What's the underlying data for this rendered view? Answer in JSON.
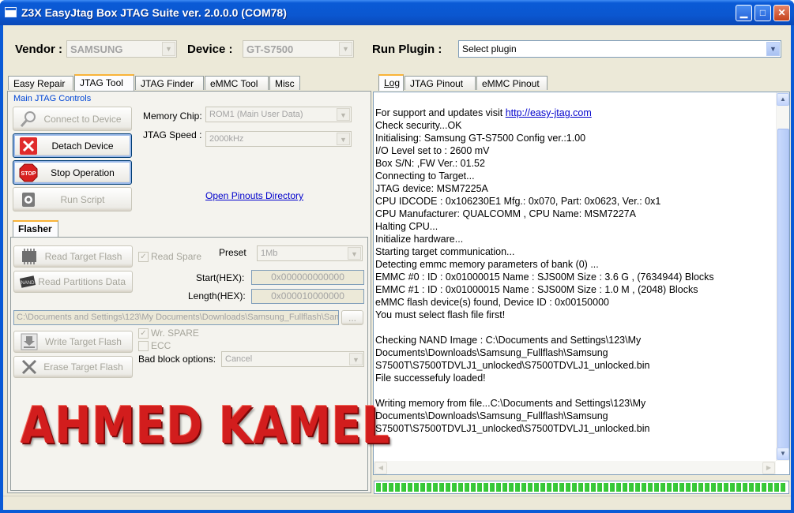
{
  "window": {
    "title": "Z3X EasyJtag Box JTAG Suite ver. 2.0.0.0 (COM78)"
  },
  "toolbar": {
    "vendor_label": "Vendor :",
    "vendor_value": "SAMSUNG",
    "device_label": "Device :",
    "device_value": "GT-S7500",
    "plugin_label": "Run Plugin :",
    "plugin_value": "Select plugin"
  },
  "left_tabs": [
    "Easy Repair",
    "JTAG Tool",
    "JTAG Finder",
    "eMMC Tool",
    "Misc"
  ],
  "left_active_tab": "JTAG Tool",
  "jtag_controls": {
    "group_title": "Main JTAG Controls",
    "connect_label": "Connect to Device",
    "detach_label": "Detach Device",
    "stop_label": "Stop Operation",
    "script_label": "Run Script",
    "memchip_label": "Memory Chip:",
    "memchip_value": "ROM1 (Main User Data)",
    "speed_label": "JTAG Speed :",
    "speed_value": "2000kHz",
    "pinouts_link": "Open Pinouts Directory"
  },
  "flasher": {
    "tab_label": "Flasher",
    "read_target_label": "Read Target Flash",
    "read_partitions_label": "Read Partitions Data",
    "read_spare_label": "Read Spare",
    "preset_label": "Preset",
    "preset_value": "1Mb",
    "start_label": "Start(HEX):",
    "start_value": "0x000000000000",
    "length_label": "Length(HEX):",
    "length_value": "0x000010000000",
    "file_path": "C:\\Documents and Settings\\123\\My Documents\\Downloads\\Samsung_Fullflash\\Sam",
    "browse_label": "...",
    "write_target_label": "Write Target Flash",
    "erase_target_label": "Erase Target Flash",
    "wr_spare_label": "Wr. SPARE",
    "ecc_label": "ECC",
    "badblock_label": "Bad block options:",
    "badblock_value": "Cancel"
  },
  "right_tabs": [
    "Log",
    "JTAG Pinout",
    "eMMC Pinout"
  ],
  "right_active_tab": "Log",
  "log": {
    "support_prefix": "For support and updates visit ",
    "support_link": "http://easy-jtag.com",
    "lines": [
      "Check security...OK",
      "Initialising: Samsung GT-S7500 Config ver.:1.00",
      "I/O Level set to : 2600 mV",
      "Box S/N:                    ,FW Ver.: 01.52",
      "Connecting to Target...",
      "JTAG device: MSM7225A",
      "CPU IDCODE : 0x106230E1 Mfg.: 0x070, Part: 0x0623, Ver.: 0x1",
      "CPU Manufacturer: QUALCOMM , CPU Name: MSM7227A",
      "Halting CPU...",
      "Initialize hardware...",
      "Starting target communication...",
      "Detecting emmc memory parameters of bank (0) ...",
      "EMMC #0 : ID : 0x01000015 Name : SJS00M Size : 3.6 G , (7634944) Blocks",
      "EMMC #1 : ID : 0x01000015 Name : SJS00M Size : 1.0 M , (2048) Blocks",
      "eMMC flash device(s) found, Device ID : 0x00150000",
      "You must select flash file first!",
      "",
      "Checking NAND Image : C:\\Documents and Settings\\123\\My",
      "Documents\\Downloads\\Samsung_Fullflash\\Samsung",
      "S7500T\\S7500TDVLJ1_unlocked\\S7500TDVLJ1_unlocked.bin",
      "File successefuly loaded!",
      "",
      "Writing memory from file...C:\\Documents and Settings\\123\\My",
      "Documents\\Downloads\\Samsung_Fullflash\\Samsung",
      "S7500T\\S7500TDVLJ1_unlocked\\S7500TDVLJ1_unlocked.bin"
    ]
  },
  "progress_fraction": 1.0,
  "watermark_text": "AHMED KAMEL",
  "colors": {
    "title_blue": "#0a5ad6",
    "progress_green": "#3cd03c",
    "watermark_red": "#d21d1d"
  }
}
